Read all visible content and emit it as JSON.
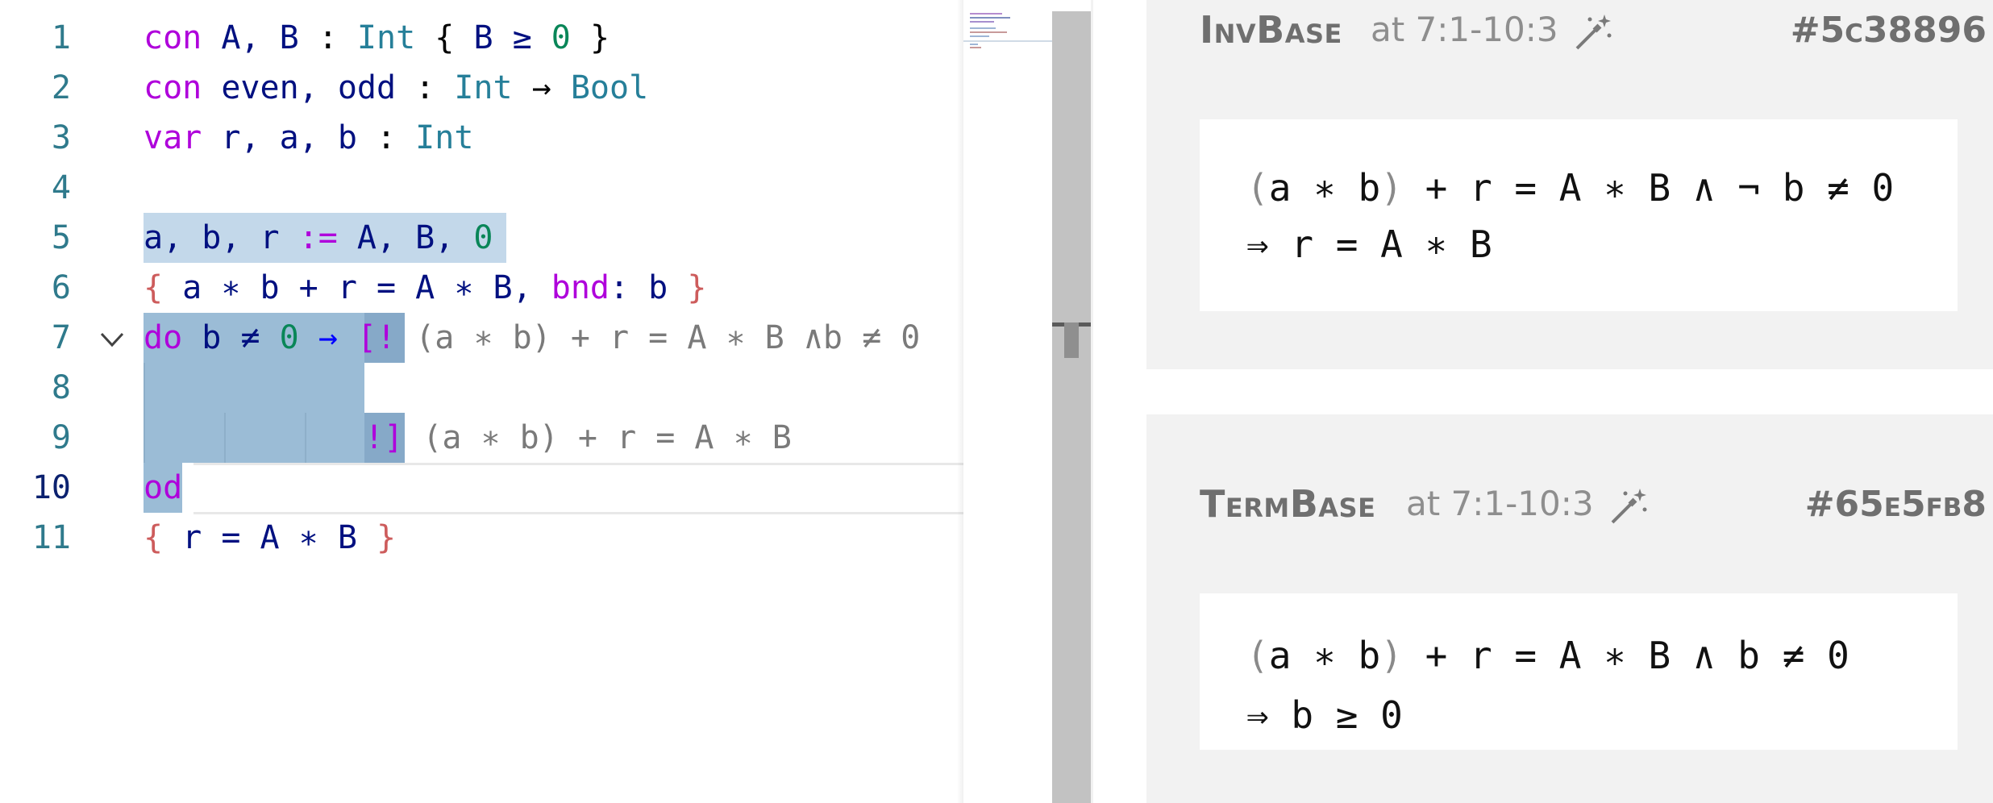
{
  "editor": {
    "lines": [
      {
        "n": "1"
      },
      {
        "n": "2"
      },
      {
        "n": "3"
      },
      {
        "n": "4"
      },
      {
        "n": "5"
      },
      {
        "n": "6"
      },
      {
        "n": "7"
      },
      {
        "n": "8"
      },
      {
        "n": "9"
      },
      {
        "n": "10"
      },
      {
        "n": "11"
      }
    ],
    "tokens": {
      "l1_kw": "con",
      "l1_a": " A, B ",
      "l1_colon": ":",
      "l1_ty": " Int ",
      "l1_br1": "{",
      "l1_b": " B ≥ ",
      "l1_num": "0",
      "l1_br2": " }",
      "l2_kw": "con",
      "l2_a": " even, odd ",
      "l2_colon": ":",
      "l2_ty": " Int",
      "l2_arrow": " → ",
      "l2_ty2": "Bool",
      "l3_kw": "var",
      "l3_a": " r, a, b ",
      "l3_colon": ":",
      "l3_ty": " Int",
      "l5_a": "a, b, r ",
      "l5_op": ":=",
      "l5_b": " A, B, ",
      "l5_num": "0",
      "l6_br1": "{",
      "l6_a": " a ∗ b + r = A ∗ B, ",
      "l6_kw": "bnd",
      "l6_b": ": b ",
      "l6_br2": "}",
      "l7_kw": "do",
      "l7_a": " b ≠ ",
      "l7_num": "0",
      "l7_arrow": " → ",
      "l7_hole": "[!",
      "l7_hint": " (a ∗ b) + r = A ∗ B ∧b ≠ 0",
      "l9_hole": "!]",
      "l9_hint": " (a ∗ b) + r = A ∗ B",
      "l10_kw": "od",
      "l11_br1": "{",
      "l11_a": " r = A ∗ B ",
      "l11_br2": "}"
    }
  },
  "panel": {
    "cards": [
      {
        "title": "InvBase",
        "location": "at 7:1-10:3",
        "hash": "#5c38896",
        "line1_a": "(",
        "line1_b": "a ∗ b",
        "line1_c": ")",
        "line1_d": " + r = A ∗ B ∧ ¬ b ≠ 0",
        "line2": "⇒ r = A ∗ B",
        "icon": "magic-wand-icon"
      },
      {
        "title": "TermBase",
        "location": "at 7:1-10:3",
        "hash": "#65e5fb8",
        "line1_a": "(",
        "line1_b": "a ∗ b",
        "line1_c": ")",
        "line1_d": " + r = A ∗ B ∧ b ≠ 0",
        "line2": "⇒ b ≥ 0",
        "icon": "magic-wand-icon"
      }
    ]
  },
  "colors": {
    "keyword": "#af00db",
    "type": "#267f99",
    "number": "#098658",
    "identifier": "#001080",
    "brace": "#cd5c5c",
    "selection": "#c3d8ea",
    "hole_block": "#9bbcd6"
  }
}
